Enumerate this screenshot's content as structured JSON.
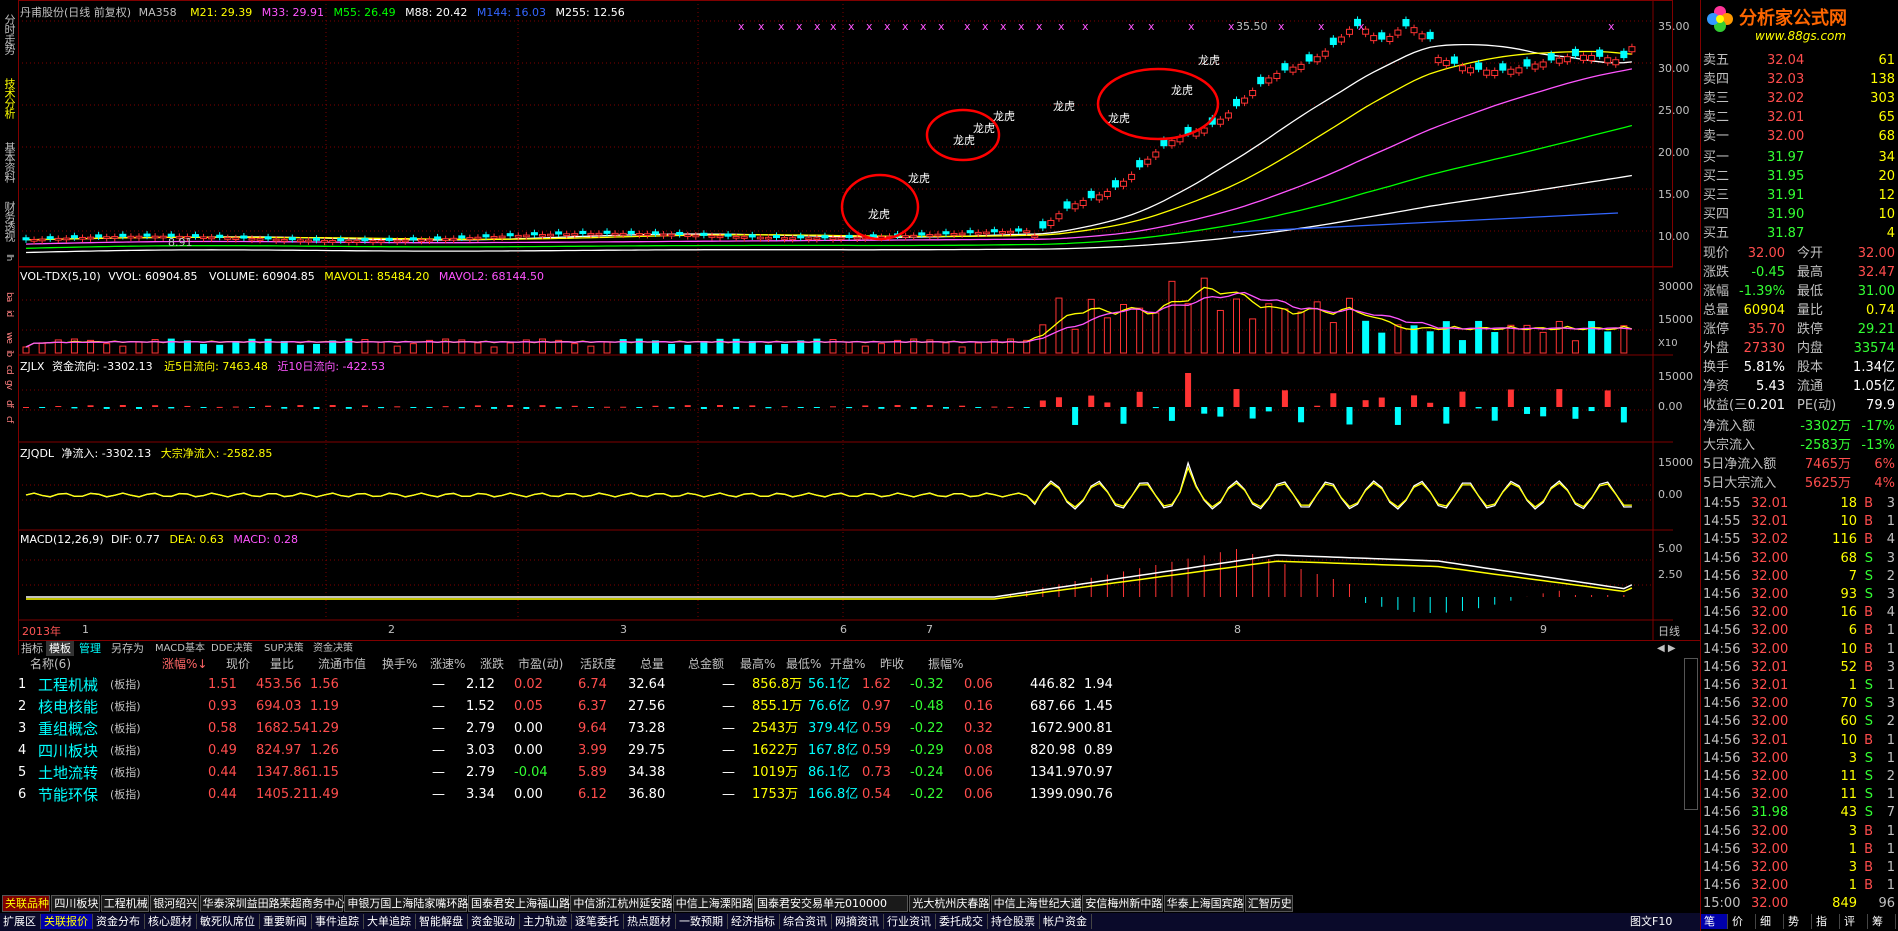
{
  "colors": {
    "up": "#ff3333",
    "down": "#00ffff",
    "yellow": "#ffff00",
    "green": "#00ff00",
    "border": "#800000",
    "bg": "#000000"
  },
  "left_tabs": [
    "分时走势",
    "技术分析",
    "基本资料",
    "财务透视"
  ],
  "chart": {
    "title": "丹甫股份(日线 前复权)",
    "indicator_name": "MA358",
    "ma": [
      {
        "label": "M21: 29.39",
        "color": "#ffff00"
      },
      {
        "label": "M33: 29.91",
        "color": "#ff55ff"
      },
      {
        "label": "M55: 26.49",
        "color": "#00ff00"
      },
      {
        "label": "M88: 20.42",
        "color": "#ffffff"
      },
      {
        "label": "M144: 16.03",
        "color": "#3366ff"
      },
      {
        "label": "M255: 12.56",
        "color": "#ffffff"
      }
    ],
    "price_ticks": [
      "35.00",
      "30.00",
      "25.00",
      "20.00",
      "15.00",
      "10.00"
    ],
    "high_label": "35.50",
    "low_label": "8.91",
    "annotations": [
      "龙虎",
      "龙虎",
      "龙虎",
      "龙虎",
      "龙虎",
      "龙虎",
      "龙虎",
      "龙虎",
      "龙虎"
    ],
    "vol": {
      "name": "VOL-TDX(5,10)",
      "vvol": "VVOL: 60904.85",
      "volume": "VOLUME: 60904.85",
      "mavol1": "MAVOL1: 85484.20",
      "mavol2": "MAVOL2: 68144.50",
      "ticks": [
        "30000",
        "15000"
      ],
      "x10": "X10",
      "side": [
        "ba",
        "id",
        "we",
        "ib"
      ]
    },
    "zjlx": {
      "name": "ZJLX",
      "flow": "资金流向: -3302.13",
      "five": "近5日流向: 7463.48",
      "ten": "近10日流向: -422.53",
      "ticks": [
        "15000",
        "0.00"
      ],
      "side": [
        "cd",
        "gv",
        "df",
        "cf"
      ]
    },
    "zjqdl": {
      "name": "ZJQDL",
      "net": "净流入: -3302.13",
      "big": "大宗净流入: -2582.85",
      "ticks": [
        "15000",
        "0.00"
      ]
    },
    "macd": {
      "name": "MACD(12,26,9)",
      "dif": "DIF: 0.77",
      "dea": "DEA: 0.63",
      "macd": "MACD: 0.28",
      "ticks": [
        "5.00",
        "2.50"
      ]
    },
    "xaxis": {
      "year": "2013年",
      "months": [
        "1",
        "2",
        "3",
        "6",
        "7",
        "8",
        "9"
      ],
      "right": "日线"
    },
    "lh": "lh"
  },
  "toolbar": {
    "items": [
      "指标",
      "模板",
      "管理",
      "另存为",
      "MACD基本",
      "DDE决策",
      "SUP决策",
      "资金决策"
    ]
  },
  "table": {
    "headers": [
      "名称(6)",
      "涨幅%↓",
      "现价",
      "量比",
      "流通市值",
      "换手%",
      "涨速%",
      "涨跌",
      "市盈(动)",
      "活跃度",
      "总量",
      "总金额",
      "最高%",
      "最低%",
      "开盘%",
      "昨收",
      "振幅%"
    ],
    "rows": [
      {
        "idx": "1",
        "name": "工程机械",
        "tag": "(板指)",
        "chg": "1.51",
        "price": "453.56",
        "lb": "1.56",
        "mv": "—",
        "hs": "2.12",
        "sp": "0.02",
        "zd": "6.74",
        "pe": "32.64",
        "hy": "—",
        "zl": "856.8万",
        "je": "56.1亿",
        "hi": "1.62",
        "lo": "-0.32",
        "op": "0.06",
        "zs": "446.82",
        "zf": "1.94",
        "spc": "red",
        "hic": "red",
        "loc": "green",
        "opc": "red"
      },
      {
        "idx": "2",
        "name": "核电核能",
        "tag": "(板指)",
        "chg": "0.93",
        "price": "694.03",
        "lb": "1.19",
        "mv": "—",
        "hs": "1.52",
        "sp": "0.05",
        "zd": "6.37",
        "pe": "27.56",
        "hy": "—",
        "zl": "855.1万",
        "je": "76.6亿",
        "hi": "0.97",
        "lo": "-0.48",
        "op": "0.16",
        "zs": "687.66",
        "zf": "1.45",
        "spc": "red",
        "hic": "red",
        "loc": "green",
        "opc": "red"
      },
      {
        "idx": "3",
        "name": "重组概念",
        "tag": "(板指)",
        "chg": "0.58",
        "price": "1682.54",
        "lb": "1.29",
        "mv": "—",
        "hs": "2.79",
        "sp": "0.00",
        "zd": "9.64",
        "pe": "73.28",
        "hy": "—",
        "zl": "2543万",
        "je": "379.4亿",
        "hi": "0.59",
        "lo": "-0.22",
        "op": "0.32",
        "zs": "1672.90",
        "zf": "0.81",
        "spc": "white",
        "hic": "red",
        "loc": "green",
        "opc": "red"
      },
      {
        "idx": "4",
        "name": "四川板块",
        "tag": "(板指)",
        "chg": "0.49",
        "price": "824.97",
        "lb": "1.26",
        "mv": "—",
        "hs": "3.03",
        "sp": "0.00",
        "zd": "3.99",
        "pe": "29.75",
        "hy": "—",
        "zl": "1622万",
        "je": "167.8亿",
        "hi": "0.59",
        "lo": "-0.29",
        "op": "0.08",
        "zs": "820.98",
        "zf": "0.89",
        "spc": "white",
        "hic": "red",
        "loc": "green",
        "opc": "red"
      },
      {
        "idx": "5",
        "name": "土地流转",
        "tag": "(板指)",
        "chg": "0.44",
        "price": "1347.86",
        "lb": "1.15",
        "mv": "—",
        "hs": "2.79",
        "sp": "-0.04",
        "zd": "5.89",
        "pe": "34.38",
        "hy": "—",
        "zl": "1019万",
        "je": "86.1亿",
        "hi": "0.73",
        "lo": "-0.24",
        "op": "0.06",
        "zs": "1341.97",
        "zf": "0.97",
        "spc": "green",
        "hic": "red",
        "loc": "green",
        "opc": "red"
      },
      {
        "idx": "6",
        "name": "节能环保",
        "tag": "(板指)",
        "chg": "0.44",
        "price": "1405.21",
        "lb": "1.49",
        "mv": "—",
        "hs": "3.34",
        "sp": "0.00",
        "zd": "6.12",
        "pe": "36.80",
        "hy": "—",
        "zl": "1753万",
        "je": "166.8亿",
        "hi": "0.54",
        "lo": "-0.22",
        "op": "0.06",
        "zs": "1399.09",
        "zf": "0.76",
        "spc": "white",
        "hic": "red",
        "loc": "green",
        "opc": "red"
      }
    ]
  },
  "bottom_tabs": [
    "关联品种",
    "四川板块",
    "工程机械",
    "银河绍兴",
    "华泰深圳益田路荣超商务中心",
    "申银万国上海陆家嘴环路",
    "国泰君安上海福山路",
    "中信浙江杭州延安路",
    "中信上海溧阳路",
    "国泰君安交易单元010000",
    "光大杭州庆春路",
    "中信上海世纪大道",
    "安信梅州新中路",
    "华泰上海国宾路",
    "汇智历史"
  ],
  "status_items": [
    "扩展区",
    "关联报价",
    "资金分布",
    "核心题材",
    "敏死队席位",
    "重要新闻",
    "事件追踪",
    "大单追踪",
    "智能解盘",
    "资金驱动",
    "主力轨迹",
    "逐笔委托",
    "热点题材",
    "一致预期",
    "经济指标",
    "综合资讯",
    "网摘资讯",
    "行业资讯",
    "委托成交",
    "持仓股票",
    "帐户资金"
  ],
  "status_right": "图文F10",
  "logo": {
    "main": "分析家公式网",
    "url": "www.88gs.com"
  },
  "quote": {
    "asks": [
      {
        "l": "卖五",
        "p": "32.04",
        "v": "61"
      },
      {
        "l": "卖四",
        "p": "32.03",
        "v": "138"
      },
      {
        "l": "卖三",
        "p": "32.02",
        "v": "303"
      },
      {
        "l": "卖二",
        "p": "32.01",
        "v": "65"
      },
      {
        "l": "卖一",
        "p": "32.00",
        "v": "68"
      }
    ],
    "bids": [
      {
        "l": "买一",
        "p": "31.97",
        "v": "34"
      },
      {
        "l": "买二",
        "p": "31.95",
        "v": "20"
      },
      {
        "l": "买三",
        "p": "31.91",
        "v": "12"
      },
      {
        "l": "买四",
        "p": "31.90",
        "v": "10"
      },
      {
        "l": "买五",
        "p": "31.87",
        "v": "4"
      }
    ],
    "stats": [
      {
        "a": "现价",
        "av": "32.00",
        "b": "今开",
        "bv": "32.00",
        "avc": "red",
        "bvc": "red"
      },
      {
        "a": "涨跌",
        "av": "-0.45",
        "b": "最高",
        "bv": "32.47",
        "avc": "green",
        "bvc": "red"
      },
      {
        "a": "涨幅",
        "av": "-1.39%",
        "b": "最低",
        "bv": "31.00",
        "avc": "green",
        "bvc": "green"
      },
      {
        "a": "总量",
        "av": "60904",
        "b": "量比",
        "bv": "0.74",
        "avc": "yellow",
        "bvc": "yellow"
      },
      {
        "a": "涨停",
        "av": "35.70",
        "b": "跌停",
        "bv": "29.21",
        "avc": "red",
        "bvc": "green"
      },
      {
        "a": "外盘",
        "av": "27330",
        "b": "内盘",
        "bv": "33574",
        "avc": "red",
        "bvc": "green"
      },
      {
        "a": "换手",
        "av": "5.81%",
        "b": "股本",
        "bv": "1.34亿",
        "avc": "white",
        "bvc": "white"
      },
      {
        "a": "净资",
        "av": "5.43",
        "b": "流通",
        "bv": "1.05亿",
        "avc": "white",
        "bvc": "white"
      },
      {
        "a": "收益(三",
        "av": "0.201",
        "b": "PE(动)",
        "bv": "79.9",
        "avc": "white",
        "bvc": "white"
      }
    ],
    "flows": [
      {
        "l": "净流入额",
        "v": "-3302万",
        "p": "-17%",
        "vc": "green",
        "pc": "green"
      },
      {
        "l": "大宗流入",
        "v": "-2583万",
        "p": "-13%",
        "vc": "green",
        "pc": "green"
      },
      {
        "l": "5日净流入额",
        "v": "7465万",
        "p": "6%",
        "vc": "red",
        "pc": "red"
      },
      {
        "l": "5日大宗流入",
        "v": "5625万",
        "p": "4%",
        "vc": "red",
        "pc": "red"
      }
    ],
    "ticks": [
      {
        "t": "14:55",
        "p": "32.01",
        "v": "18",
        "d": "B",
        "n": "3"
      },
      {
        "t": "14:55",
        "p": "32.01",
        "v": "10",
        "d": "B",
        "n": "1"
      },
      {
        "t": "14:55",
        "p": "32.02",
        "v": "116",
        "d": "B",
        "n": "4"
      },
      {
        "t": "14:56",
        "p": "32.00",
        "v": "68",
        "d": "S",
        "n": "3"
      },
      {
        "t": "14:56",
        "p": "32.00",
        "v": "7",
        "d": "S",
        "n": "2"
      },
      {
        "t": "14:56",
        "p": "32.00",
        "v": "93",
        "d": "S",
        "n": "3"
      },
      {
        "t": "14:56",
        "p": "32.00",
        "v": "16",
        "d": "B",
        "n": "4"
      },
      {
        "t": "14:56",
        "p": "32.00",
        "v": "6",
        "d": "B",
        "n": "1"
      },
      {
        "t": "14:56",
        "p": "32.00",
        "v": "10",
        "d": "B",
        "n": "1"
      },
      {
        "t": "14:56",
        "p": "32.01",
        "v": "52",
        "d": "B",
        "n": "3"
      },
      {
        "t": "14:56",
        "p": "32.01",
        "v": "1",
        "d": "S",
        "n": "1"
      },
      {
        "t": "14:56",
        "p": "32.00",
        "v": "70",
        "d": "S",
        "n": "3"
      },
      {
        "t": "14:56",
        "p": "32.00",
        "v": "60",
        "d": "S",
        "n": "2"
      },
      {
        "t": "14:56",
        "p": "32.01",
        "v": "10",
        "d": "B",
        "n": "1"
      },
      {
        "t": "14:56",
        "p": "32.00",
        "v": "3",
        "d": "S",
        "n": "1"
      },
      {
        "t": "14:56",
        "p": "32.00",
        "v": "11",
        "d": "S",
        "n": "2"
      },
      {
        "t": "14:56",
        "p": "32.00",
        "v": "11",
        "d": "S",
        "n": "1"
      },
      {
        "t": "14:56",
        "p": "31.98",
        "v": "43",
        "d": "S",
        "n": "7"
      },
      {
        "t": "14:56",
        "p": "32.00",
        "v": "3",
        "d": "B",
        "n": "1"
      },
      {
        "t": "14:56",
        "p": "32.00",
        "v": "1",
        "d": "B",
        "n": "1"
      },
      {
        "t": "14:56",
        "p": "32.00",
        "v": "3",
        "d": "B",
        "n": "1"
      },
      {
        "t": "14:56",
        "p": "32.00",
        "v": "1",
        "d": "B",
        "n": "1"
      },
      {
        "t": "15:00",
        "p": "32.00",
        "v": "849",
        "d": "",
        "n": "96"
      }
    ],
    "footer": [
      "笔",
      "价",
      "细",
      "势",
      "指",
      "评",
      "筹"
    ]
  }
}
